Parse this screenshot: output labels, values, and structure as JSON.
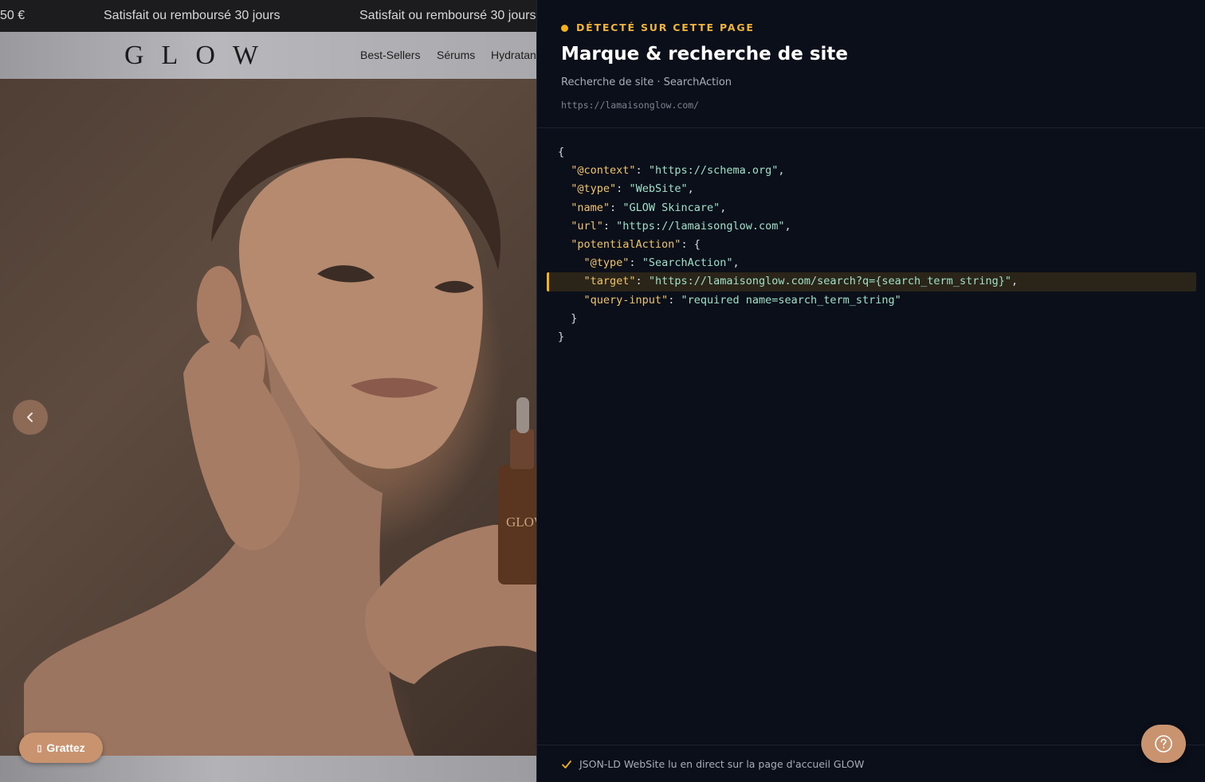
{
  "announcement": {
    "items": [
      "50 €",
      "Satisfait ou remboursé 30 jours",
      "Satisfait ou remboursé 30 jours"
    ]
  },
  "header": {
    "logo": "GLOW",
    "nav": [
      "Best-Sellers",
      "Sérums",
      "Hydratan"
    ]
  },
  "hero": {
    "bottle_label": "GLOW",
    "prev_icon": "chevron-left-icon"
  },
  "grattez": {
    "icon": "gift-icon",
    "label": "Grattez"
  },
  "panel": {
    "detect_label": "DÉTECTÉ SUR CETTE PAGE",
    "title": "Marque & recherche de site",
    "subtitle": "Recherche de site · SearchAction",
    "url": "https://lamaisonglow.com/",
    "code": {
      "context_key": "\"@context\"",
      "context_val": "\"https://schema.org\"",
      "type_key": "\"@type\"",
      "type_val": "\"WebSite\"",
      "name_key": "\"name\"",
      "name_val": "\"GLOW Skincare\"",
      "url_key": "\"url\"",
      "url_val": "\"https://lamaisonglow.com\"",
      "action_key": "\"potentialAction\"",
      "atype_key": "\"@type\"",
      "atype_val": "\"SearchAction\"",
      "target_key": "\"target\"",
      "target_val": "\"https://lamaisonglow.com/search?q={search_term_string}\"",
      "query_key": "\"query-input\"",
      "query_val": "\"required name=search_term_string\""
    },
    "footer_text": "JSON-LD WebSite lu en direct sur la page d'accueil GLOW"
  },
  "help": {
    "icon": "help-icon"
  },
  "colors": {
    "accent": "#f2b21b",
    "panel_bg": "#0b0f1a",
    "json_key": "#f0c46a",
    "json_string": "#9fe0c8",
    "cta": "#c99370"
  }
}
